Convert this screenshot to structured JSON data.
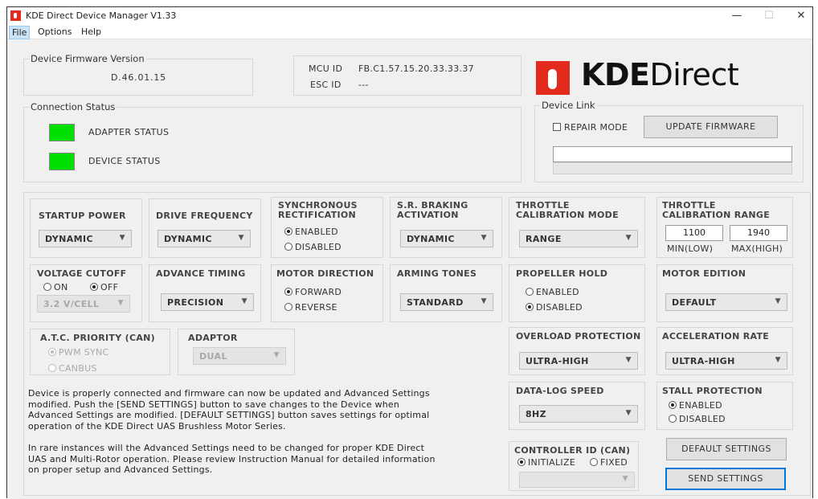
{
  "window": {
    "title": "KDE Direct Device Manager V1.33",
    "controls": {
      "minimize": "—",
      "maximize": "☐",
      "close": "✕"
    }
  },
  "menu": {
    "file": "File",
    "options": "Options",
    "help": "Help"
  },
  "firmware": {
    "title": "Device Firmware Version",
    "version": "D.46.01.15"
  },
  "ids": {
    "mcu_label": "MCU ID",
    "mcu_value": "FB.C1.57.15.20.33.33.37",
    "esc_label": "ESC ID",
    "esc_value": "---"
  },
  "logo": {
    "bold": "KDE",
    "light": "Direct",
    "brand_color": "#e32b1d"
  },
  "connection": {
    "title": "Connection Status",
    "adapter_label": "ADAPTER STATUS",
    "device_label": "DEVICE STATUS",
    "led_color": "#00e000"
  },
  "device_link": {
    "title": "Device Link",
    "repair_mode": "REPAIR MODE",
    "update_button": "UPDATE FIRMWARE",
    "path_value": ""
  },
  "settings": {
    "startup_power": {
      "label": "STARTUP POWER",
      "value": "DYNAMIC"
    },
    "drive_frequency": {
      "label": "DRIVE FREQUENCY",
      "value": "DYNAMIC"
    },
    "sync_rect": {
      "label_1": "SYNCHRONOUS",
      "label_2": "RECTIFICATION",
      "opt_enabled": "ENABLED",
      "opt_disabled": "DISABLED"
    },
    "sr_braking": {
      "label_1": "S.R. BRAKING",
      "label_2": "ACTIVATION",
      "value": "DYNAMIC"
    },
    "throttle_cal_mode": {
      "label_1": "THROTTLE",
      "label_2": "CALIBRATION MODE",
      "value": "RANGE"
    },
    "throttle_cal_range": {
      "label_1": "THROTTLE",
      "label_2": "CALIBRATION RANGE",
      "min": "1100",
      "max": "1940",
      "min_label": "MIN(LOW)",
      "max_label": "MAX(HIGH)"
    },
    "voltage_cutoff": {
      "label": "VOLTAGE CUTOFF",
      "opt_on": "ON",
      "opt_off": "OFF",
      "value": "3.2 V/CELL"
    },
    "advance_timing": {
      "label": "ADVANCE TIMING",
      "value": "PRECISION"
    },
    "motor_direction": {
      "label": "MOTOR DIRECTION",
      "opt_forward": "FORWARD",
      "opt_reverse": "REVERSE"
    },
    "arming_tones": {
      "label": "ARMING TONES",
      "value": "STANDARD"
    },
    "propeller_hold": {
      "label": "PROPELLER HOLD",
      "opt_enabled": "ENABLED",
      "opt_disabled": "DISABLED"
    },
    "motor_edition": {
      "label": "MOTOR EDITION",
      "value": "DEFAULT"
    },
    "atc_priority": {
      "label": "A.T.C. PRIORITY (CAN)",
      "opt_pwm": "PWM SYNC",
      "opt_canbus": "CANBUS"
    },
    "adaptor": {
      "label": "ADAPTOR",
      "value": "DUAL"
    },
    "overload_protection": {
      "label": "OVERLOAD PROTECTION",
      "value": "ULTRA-HIGH"
    },
    "acceleration_rate": {
      "label": "ACCELERATION RATE",
      "value": "ULTRA-HIGH"
    },
    "datalog_speed": {
      "label": "DATA-LOG SPEED",
      "value": "8HZ"
    },
    "stall_protection": {
      "label": "STALL PROTECTION",
      "opt_enabled": "ENABLED",
      "opt_disabled": "DISABLED"
    },
    "controller_id": {
      "label": "CONTROLLER ID (CAN)",
      "opt_initialize": "INITIALIZE",
      "opt_fixed": "FIXED",
      "value": ""
    }
  },
  "info": {
    "line1": "Device is properly connected and firmware can now be updated and Advanced Settings",
    "line2": "modified.  Push the [SEND SETTINGS] button to save changes to the Device when",
    "line3": "Advanced Settings are modified.  [DEFAULT SETTINGS] button saves settings for optimal",
    "line4": "operation of the KDE Direct UAS Brushless Motor Series.",
    "line5": "In rare instances will the Advanced Settings need to be changed for proper KDE Direct",
    "line6": "UAS and Multi-Rotor operation.  Please review Instruction Manual for detailed information",
    "line7": "on proper setup and Advanced Settings."
  },
  "buttons": {
    "default_settings": "DEFAULT SETTINGS",
    "send_settings": "SEND SETTINGS"
  },
  "icons": {
    "chevron": "chevron-down-icon",
    "app": "kde-app-icon"
  }
}
